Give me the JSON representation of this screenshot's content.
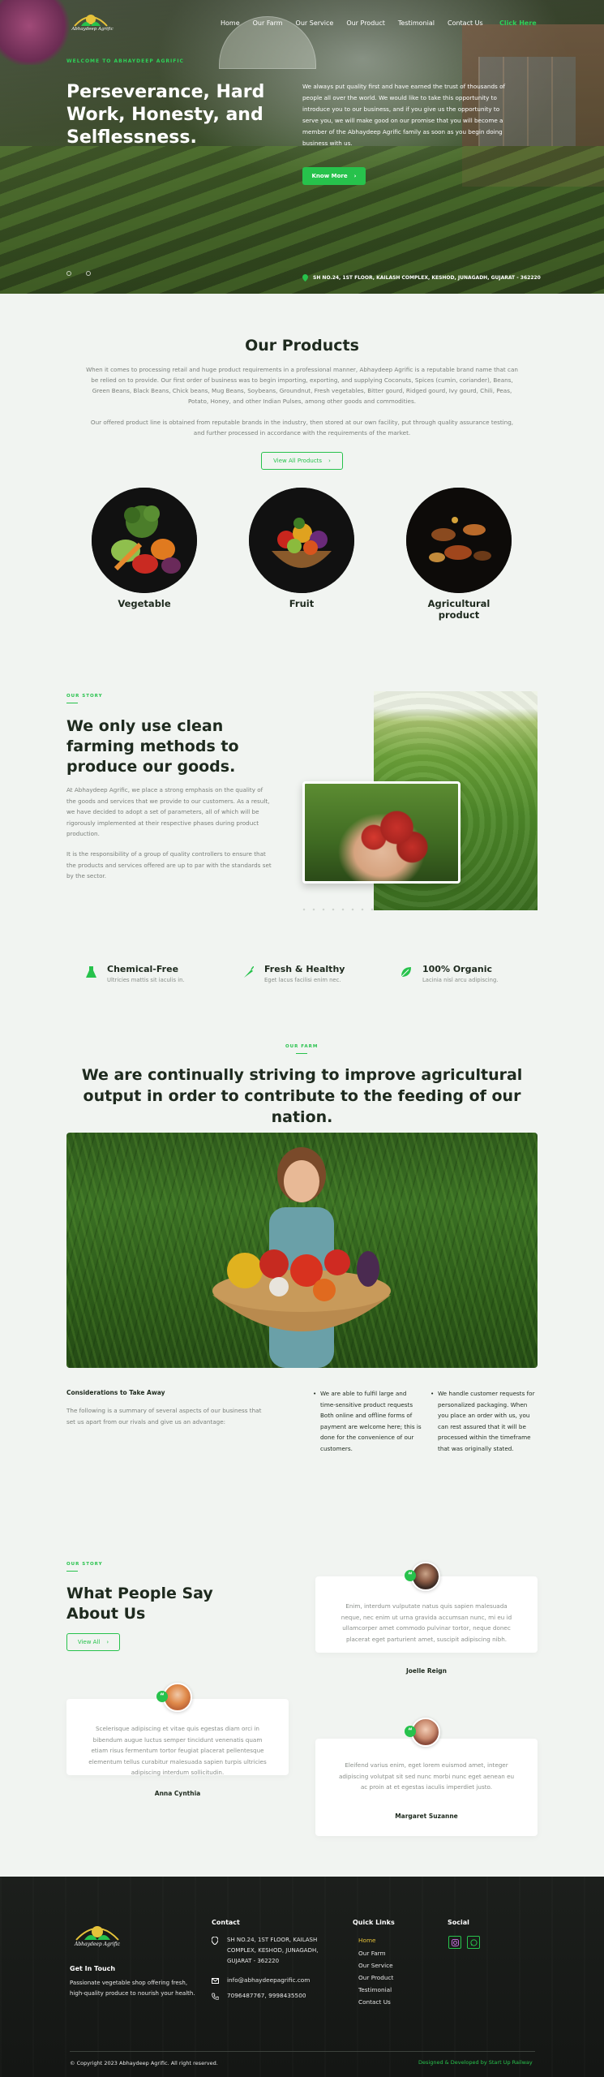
{
  "brand": {
    "logo_text": "Abhaydeep Agrific"
  },
  "nav": {
    "items": [
      "Home",
      "Our Farm",
      "Our Service",
      "Our Product",
      "Testimonial",
      "Contact Us"
    ],
    "cta": "Click Here"
  },
  "hero": {
    "eyebrow": "WELCOME TO ABHAYDEEP AGRIFIC",
    "title": "Perseverance, Hard Work, Honesty, and Selflessness.",
    "text": "We always put quality first and have earned the trust of thousands of people all over the world. We would like to take this opportunity to introduce you to our business, and if you give us the opportunity to serve you, we will make good on our promise that you will become a member of the Abhaydeep Agrific family as soon as you begin doing business with us.",
    "button": "Know More",
    "address": "SH NO.24, 1ST FLOOR, KAILASH COMPLEX, KESHOD, JUNAGADH, GUJARAT - 362220"
  },
  "products": {
    "title": "Our Products",
    "p1": "When it comes to processing retail and huge product requirements in a professional manner, Abhaydeep Agrific is a reputable brand name that can be relied on to provide. Our first order of business was to begin importing, exporting, and supplying Coconuts, Spices (cumin, coriander), Beans, Green Beans, Black Beans, Chick beans, Mug Beans, Soybeans, Groundnut, Fresh vegetables, Bitter gourd, Ridged gourd, Ivy gourd, Chili, Peas, Potato, Honey, and other Indian Pulses, among other goods and commodities.",
    "p2": "Our offered product line is obtained from reputable brands in the industry, then stored at our own facility, put through quality assurance testing, and further processed in accordance with the requirements of the market.",
    "button": "View All Products",
    "items": [
      {
        "label": "Vegetable"
      },
      {
        "label": "Fruit"
      },
      {
        "label": "Agricultural product"
      }
    ]
  },
  "story": {
    "eyebrow": "OUR STORY",
    "title": "We only use clean farming methods to produce our goods.",
    "p1": "At Abhaydeep Agrific, we place a strong emphasis on the quality of the goods and services that we provide to our customers. As a result, we have decided to adopt a set of parameters, all of which will be rigorously implemented at their respective phases during product production.",
    "p2": "It is the responsibility of a group of quality controllers to ensure that the products and services offered are up to par with the standards set by the sector."
  },
  "features": [
    {
      "icon": "flask-icon",
      "title": "Chemical-Free",
      "sub": "Ultricies mattis sit iaculis in."
    },
    {
      "icon": "carrot-icon",
      "title": "Fresh & Healthy",
      "sub": "Eget lacus facilisi enim nec."
    },
    {
      "icon": "leaf-icon",
      "title": "100% Organic",
      "sub": "Lacinia nisl arcu adipiscing."
    }
  ],
  "farm": {
    "eyebrow": "OUR FARM",
    "title": "We are continually striving to improve agricultural output in order to contribute to the feeding of our nation.",
    "h": "Considerations to Take Away",
    "p": "The following is a summary of several aspects of our business that set us apart from our rivals and give us an advantage:",
    "b1": "We are able to fulfil large and time-sensitive product requests Both online and offline forms of payment are welcome here; this is done for the convenience of our customers.",
    "b2": "We handle customer requests for personalized packaging. When you place an order with us, you can rest assured that it will be processed within the timeframe that was originally stated."
  },
  "testimonials": {
    "eyebrow": "OUR STORY",
    "title": "What People Say About Us",
    "button": "View All",
    "items": [
      {
        "text": "Enim, interdum vulputate natus quis sapien malesuada neque, nec enim ut urna gravida accumsan nunc, mi eu id ullamcorper amet commodo pulvinar tortor, neque donec placerat eget parturient amet, suscipit adipiscing nibh.",
        "name": "Joelle Reign"
      },
      {
        "text": "Scelerisque adipiscing et vitae quis egestas diam orci in bibendum augue luctus semper tincidunt venenatis quam etiam risus fermentum tortor feugiat placerat pellentesque elementum tellus curabitur malesuada sapien turpis ultricies adipiscing interdum sollicitudin.",
        "name": "Anna Cynthia"
      },
      {
        "text": "Eleifend varius enim, eget lorem euismod amet, integer adipiscing volutpat sit sed nunc morbi nunc eget aenean eu ac proin at et egestas iaculis imperdiet justo.",
        "name": "Margaret Suzanne"
      }
    ]
  },
  "footer": {
    "tagline_head": "Get In Touch",
    "tagline": "Passionate vegetable shop offering fresh, high-quality produce to nourish your health.",
    "contact_head": "Contact",
    "address": "SH NO.24, 1ST FLOOR, KAILASH COMPLEX, KESHOD, JUNAGADH, GUJARAT - 362220",
    "email": "info@abhaydeepagrific.com",
    "phone": "7096487767, 9998435500",
    "links_head": "Quick Links",
    "links": [
      "Home",
      "Our Farm",
      "Our Service",
      "Our Product",
      "Testimonial",
      "Contact Us"
    ],
    "social_head": "Social",
    "copyright": "© Copyright 2023 Abhaydeep Agrific. All right reserved.",
    "credit": "Designed & Developed by Start Up Railway"
  },
  "colors": {
    "accent": "#27c24c",
    "dark": "#1e2a1e",
    "footer": "#181b18",
    "active_link": "#e6c23a"
  }
}
